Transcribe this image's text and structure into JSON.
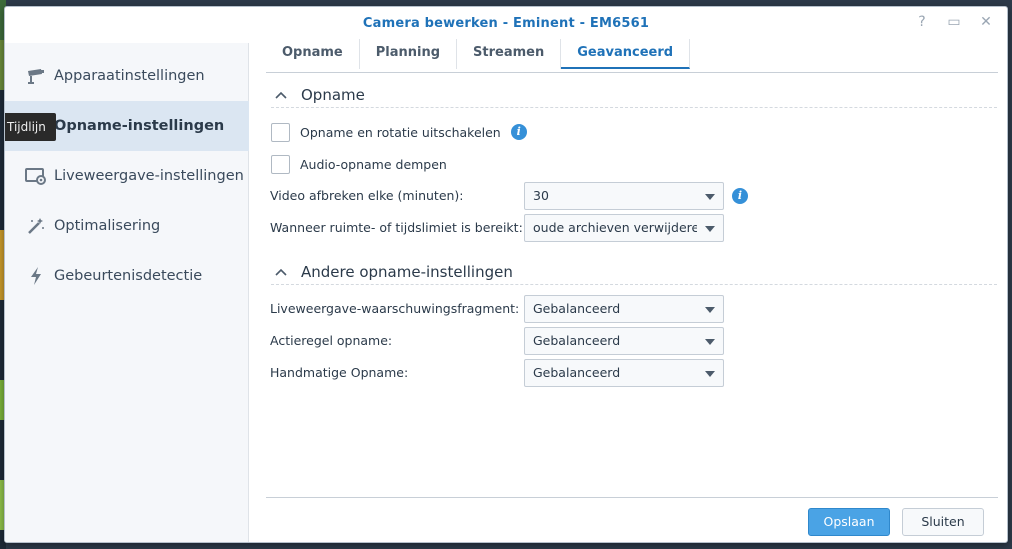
{
  "window": {
    "title": "Camera bewerken - Eminent - EM6561",
    "controls": {
      "help": "?",
      "maximize": "▭",
      "close": "✕"
    }
  },
  "sidebar": {
    "items": [
      {
        "label": "Apparaatinstellingen",
        "icon": "camera-icon"
      },
      {
        "label": "Opname-instellingen",
        "icon": "calendar-icon",
        "active": true
      },
      {
        "label": "Liveweergave-instellingen",
        "icon": "monitor-icon"
      },
      {
        "label": "Optimalisering",
        "icon": "magic-wand-icon"
      },
      {
        "label": "Gebeurtenisdetectie",
        "icon": "lightning-icon"
      }
    ],
    "tooltip": "Tijdlijn"
  },
  "tabs": [
    {
      "label": "Opname"
    },
    {
      "label": "Planning"
    },
    {
      "label": "Streamen"
    },
    {
      "label": "Geavanceerd",
      "active": true
    }
  ],
  "section_recording": {
    "title": "Opname",
    "disable_recording_label": "Opname en rotatie uitschakelen",
    "mute_audio_label": "Audio-opname dempen",
    "split_video_label": "Video afbreken elke (minuten):",
    "split_video_value": "30",
    "limit_reached_label": "Wanneer ruimte- of tijdslimiet is bereikt:",
    "limit_reached_value": "oude archieven verwijderen"
  },
  "section_other": {
    "title": "Andere opname-instellingen",
    "live_warning_label": "Liveweergave-waarschuwingsfragment:",
    "live_warning_value": "Gebalanceerd",
    "action_rule_label": "Actieregel opname:",
    "action_rule_value": "Gebalanceerd",
    "manual_label": "Handmatige Opname:",
    "manual_value": "Gebalanceerd"
  },
  "footer": {
    "save_label": "Opslaan",
    "close_label": "Sluiten"
  },
  "colors": {
    "accent": "#1f72b8",
    "primary_button": "#4aa3e5",
    "info_icon": "#3590d8",
    "active_sidebar": "#dbe6f2"
  }
}
